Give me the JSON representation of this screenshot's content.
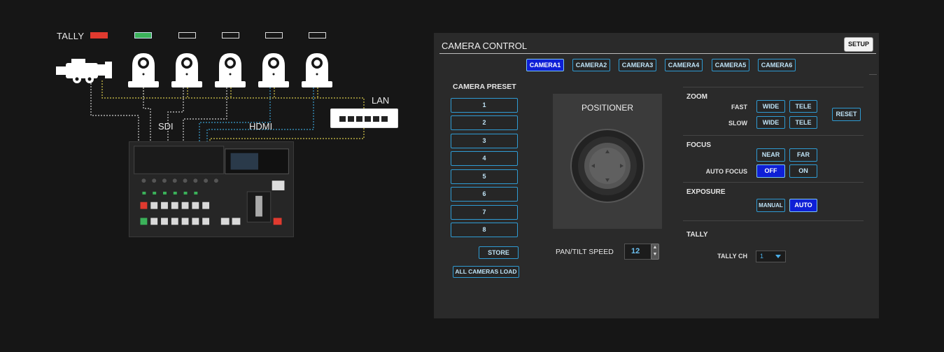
{
  "diagram": {
    "tally_label": "TALLY",
    "tally_lamps": [
      "red",
      "green",
      "off",
      "off",
      "off",
      "off"
    ],
    "sdi_label": "SDI",
    "hdmi_label": "HDMI",
    "lan_label": "LAN"
  },
  "panel": {
    "title": "CAMERA CONTROL",
    "setup_label": "SETUP",
    "cameras": [
      "CAMERA1",
      "CAMERA2",
      "CAMERA3",
      "CAMERA4",
      "CAMERA5",
      "CAMERA6"
    ],
    "selected_camera": "CAMERA1",
    "preset": {
      "title": "CAMERA PRESET",
      "buttons": [
        "1",
        "2",
        "3",
        "4",
        "5",
        "6",
        "7",
        "8"
      ],
      "store_label": "STORE",
      "load_all_label": "ALL CAMERAS LOAD"
    },
    "positioner": {
      "title": "POSITIONER",
      "speed_label": "PAN/TILT SPEED",
      "speed_value": "12"
    },
    "zoom": {
      "title": "ZOOM",
      "fast_label": "FAST",
      "slow_label": "SLOW",
      "wide_label": "WIDE",
      "tele_label": "TELE",
      "reset_label": "RESET"
    },
    "focus": {
      "title": "FOCUS",
      "near_label": "NEAR",
      "far_label": "FAR",
      "auto_focus_label": "AUTO FOCUS",
      "off_label": "OFF",
      "on_label": "ON",
      "auto_focus_value": "OFF"
    },
    "exposure": {
      "title": "EXPOSURE",
      "manual_label": "MANUAL",
      "auto_label": "AUTO",
      "value": "AUTO"
    },
    "tally": {
      "title": "TALLY",
      "ch_label": "TALLY CH",
      "ch_value": "1"
    }
  },
  "colors": {
    "accent_blue": "#2f9bd3",
    "selected_fill": "#0e1fd6",
    "tally_red": "#e03a2f",
    "tally_green": "#3bb25a"
  }
}
